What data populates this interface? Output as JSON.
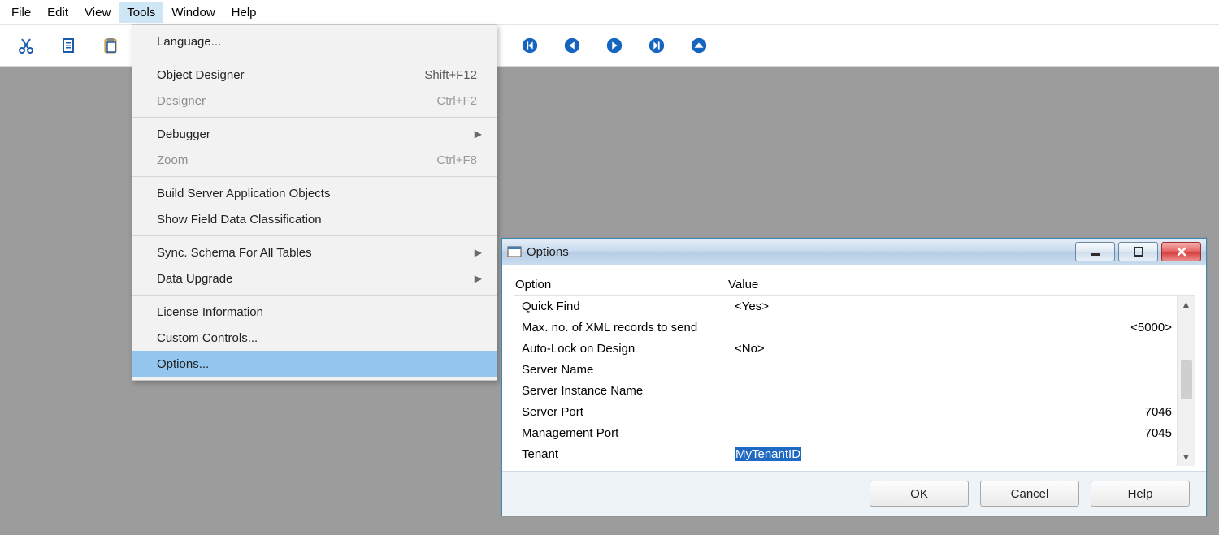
{
  "menubar": {
    "items": [
      "File",
      "Edit",
      "View",
      "Tools",
      "Window",
      "Help"
    ],
    "open_index": 3
  },
  "tools_menu": {
    "items": [
      {
        "label": "Language...",
        "enabled": true
      },
      {
        "sep": true
      },
      {
        "label": "Object Designer",
        "shortcut": "Shift+F12",
        "enabled": true
      },
      {
        "label": "Designer",
        "shortcut": "Ctrl+F2",
        "enabled": false
      },
      {
        "sep": true
      },
      {
        "label": "Debugger",
        "submenu": true,
        "enabled": true
      },
      {
        "label": "Zoom",
        "shortcut": "Ctrl+F8",
        "enabled": false
      },
      {
        "sep": true
      },
      {
        "label": "Build Server Application Objects",
        "enabled": true
      },
      {
        "label": "Show Field Data Classification",
        "enabled": true
      },
      {
        "sep": true
      },
      {
        "label": "Sync. Schema For All Tables",
        "submenu": true,
        "enabled": true
      },
      {
        "label": "Data Upgrade",
        "submenu": true,
        "enabled": true
      },
      {
        "sep": true
      },
      {
        "label": "License Information",
        "enabled": true
      },
      {
        "label": "Custom Controls...",
        "enabled": true
      },
      {
        "label": "Options...",
        "enabled": true,
        "highlight": true
      }
    ]
  },
  "toolbar_icons": [
    "cut-icon",
    "copy-icon",
    "paste-icon",
    "nav-first-icon",
    "nav-prev-icon",
    "nav-next-icon",
    "nav-last-icon",
    "nav-up-icon"
  ],
  "dialog": {
    "title": "Options",
    "columns": {
      "option": "Option",
      "value": "Value"
    },
    "rows": [
      {
        "option": "Quick Find",
        "value": "<Yes>",
        "align": "left"
      },
      {
        "option": "Max. no. of XML records to send",
        "value": "<5000>",
        "align": "right"
      },
      {
        "option": "Auto-Lock on Design",
        "value": "<No>",
        "align": "left"
      },
      {
        "option": "Server Name",
        "value": "",
        "align": "left"
      },
      {
        "option": "Server Instance Name",
        "value": "",
        "align": "left"
      },
      {
        "option": "Server Port",
        "value": "7046",
        "align": "right"
      },
      {
        "option": "Management Port",
        "value": "7045",
        "align": "right"
      },
      {
        "option": "Tenant",
        "value": "MyTenantID",
        "align": "left",
        "selected": true
      }
    ],
    "buttons": {
      "ok": "OK",
      "cancel": "Cancel",
      "help": "Help"
    }
  }
}
